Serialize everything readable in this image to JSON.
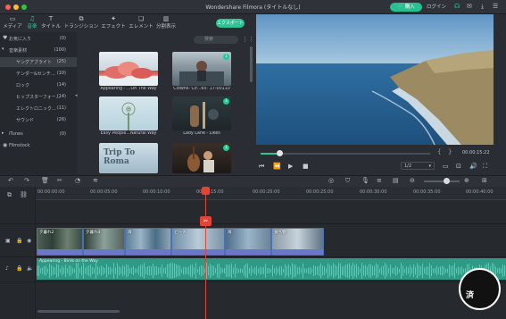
{
  "window": {
    "title": "Wondershare Filmora (タイトルなし)",
    "buy_label": "購入",
    "login_label": "ログイン"
  },
  "tabs": [
    {
      "label": "メディア",
      "icon": "folder-icon"
    },
    {
      "label": "音楽",
      "icon": "music-note-icon"
    },
    {
      "label": "タイトル",
      "icon": "text-T-icon"
    },
    {
      "label": "トランジション",
      "icon": "transition-icon"
    },
    {
      "label": "エフェクト",
      "icon": "effect-icon"
    },
    {
      "label": "エレメント",
      "icon": "element-icon"
    },
    {
      "label": "分割表示",
      "icon": "split-screen-icon"
    }
  ],
  "active_tab": "音楽",
  "export_label": "エクスポート",
  "sidebar": {
    "items": [
      {
        "label": "お気に入り",
        "count": "(0)"
      },
      {
        "label": "音楽素材",
        "count": "(100)"
      },
      {
        "label": "ヤングアブライト",
        "count": "(25)"
      },
      {
        "label": "テンダー&センチ...",
        "count": "(10)"
      },
      {
        "label": "ロック",
        "count": "(14)"
      },
      {
        "label": "ヒップスターフォー...",
        "count": "(14)"
      },
      {
        "label": "エレクトロニック...",
        "count": "(11)"
      },
      {
        "label": "サウンド",
        "count": "(26)"
      },
      {
        "label": "iTunes",
        "count": "(0)"
      },
      {
        "label": "Filmstock",
        "count": ""
      }
    ]
  },
  "search": {
    "placeholder": "検索"
  },
  "media_items": [
    {
      "label": "Appearing - ...On The Way",
      "download": false
    },
    {
      "label": "Clowns- Cir...65- 17-00110",
      "download": true
    },
    {
      "label": "Easy People...Natural Way",
      "download": false
    },
    {
      "label": "Lady Lane - Likes",
      "download": true
    },
    {
      "label": "Trip To Roma",
      "download": false
    },
    {
      "label": "",
      "download": true
    }
  ],
  "preview": {
    "timecode": "00:00:15:22",
    "progress": 0.11,
    "ratio": "1/2",
    "bracket_in": "{",
    "bracket_out": "}"
  },
  "timeline": {
    "ruler_ticks": [
      "00:00:00:00",
      "00:00:05:00",
      "00:00:10:00",
      "00:00:15:00",
      "00:00:20:00",
      "00:00:25:00",
      "00:00:30:00",
      "00:00:35:00",
      "00:00:40:00"
    ],
    "video_clips": [
      {
        "name": "夕暮れ2"
      },
      {
        "name": "夕暮れ4"
      },
      {
        "name": "海"
      },
      {
        "name": "ビーチ"
      },
      {
        "name": "海"
      },
      {
        "name": "食べ物"
      }
    ],
    "audio_clip": {
      "name": "Appearing - Birds on the Way"
    }
  },
  "watermark": {
    "text": "済"
  },
  "colors": {
    "accent": "#2cc495",
    "playhead": "#e0453a",
    "clip_border": "#4a70b5",
    "audio": "#2e9a86"
  }
}
